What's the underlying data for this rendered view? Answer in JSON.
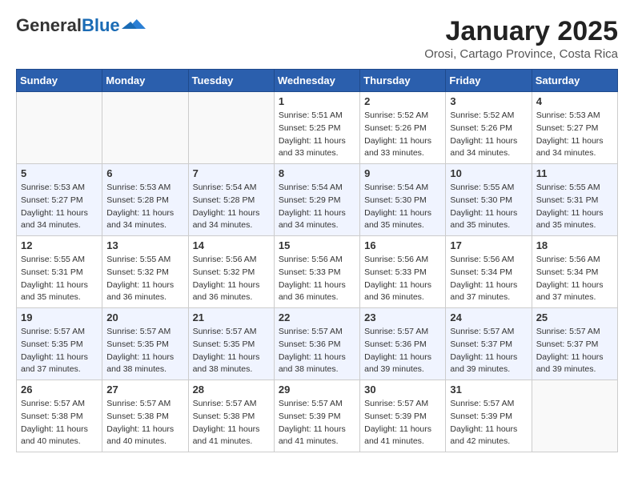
{
  "header": {
    "logo_line1": "General",
    "logo_line2": "Blue",
    "month_title": "January 2025",
    "location": "Orosi, Cartago Province, Costa Rica"
  },
  "weekdays": [
    "Sunday",
    "Monday",
    "Tuesday",
    "Wednesday",
    "Thursday",
    "Friday",
    "Saturday"
  ],
  "weeks": [
    [
      {
        "day": "",
        "info": ""
      },
      {
        "day": "",
        "info": ""
      },
      {
        "day": "",
        "info": ""
      },
      {
        "day": "1",
        "info": "Sunrise: 5:51 AM\nSunset: 5:25 PM\nDaylight: 11 hours\nand 33 minutes."
      },
      {
        "day": "2",
        "info": "Sunrise: 5:52 AM\nSunset: 5:26 PM\nDaylight: 11 hours\nand 33 minutes."
      },
      {
        "day": "3",
        "info": "Sunrise: 5:52 AM\nSunset: 5:26 PM\nDaylight: 11 hours\nand 34 minutes."
      },
      {
        "day": "4",
        "info": "Sunrise: 5:53 AM\nSunset: 5:27 PM\nDaylight: 11 hours\nand 34 minutes."
      }
    ],
    [
      {
        "day": "5",
        "info": "Sunrise: 5:53 AM\nSunset: 5:27 PM\nDaylight: 11 hours\nand 34 minutes."
      },
      {
        "day": "6",
        "info": "Sunrise: 5:53 AM\nSunset: 5:28 PM\nDaylight: 11 hours\nand 34 minutes."
      },
      {
        "day": "7",
        "info": "Sunrise: 5:54 AM\nSunset: 5:28 PM\nDaylight: 11 hours\nand 34 minutes."
      },
      {
        "day": "8",
        "info": "Sunrise: 5:54 AM\nSunset: 5:29 PM\nDaylight: 11 hours\nand 34 minutes."
      },
      {
        "day": "9",
        "info": "Sunrise: 5:54 AM\nSunset: 5:30 PM\nDaylight: 11 hours\nand 35 minutes."
      },
      {
        "day": "10",
        "info": "Sunrise: 5:55 AM\nSunset: 5:30 PM\nDaylight: 11 hours\nand 35 minutes."
      },
      {
        "day": "11",
        "info": "Sunrise: 5:55 AM\nSunset: 5:31 PM\nDaylight: 11 hours\nand 35 minutes."
      }
    ],
    [
      {
        "day": "12",
        "info": "Sunrise: 5:55 AM\nSunset: 5:31 PM\nDaylight: 11 hours\nand 35 minutes."
      },
      {
        "day": "13",
        "info": "Sunrise: 5:55 AM\nSunset: 5:32 PM\nDaylight: 11 hours\nand 36 minutes."
      },
      {
        "day": "14",
        "info": "Sunrise: 5:56 AM\nSunset: 5:32 PM\nDaylight: 11 hours\nand 36 minutes."
      },
      {
        "day": "15",
        "info": "Sunrise: 5:56 AM\nSunset: 5:33 PM\nDaylight: 11 hours\nand 36 minutes."
      },
      {
        "day": "16",
        "info": "Sunrise: 5:56 AM\nSunset: 5:33 PM\nDaylight: 11 hours\nand 36 minutes."
      },
      {
        "day": "17",
        "info": "Sunrise: 5:56 AM\nSunset: 5:34 PM\nDaylight: 11 hours\nand 37 minutes."
      },
      {
        "day": "18",
        "info": "Sunrise: 5:56 AM\nSunset: 5:34 PM\nDaylight: 11 hours\nand 37 minutes."
      }
    ],
    [
      {
        "day": "19",
        "info": "Sunrise: 5:57 AM\nSunset: 5:35 PM\nDaylight: 11 hours\nand 37 minutes."
      },
      {
        "day": "20",
        "info": "Sunrise: 5:57 AM\nSunset: 5:35 PM\nDaylight: 11 hours\nand 38 minutes."
      },
      {
        "day": "21",
        "info": "Sunrise: 5:57 AM\nSunset: 5:35 PM\nDaylight: 11 hours\nand 38 minutes."
      },
      {
        "day": "22",
        "info": "Sunrise: 5:57 AM\nSunset: 5:36 PM\nDaylight: 11 hours\nand 38 minutes."
      },
      {
        "day": "23",
        "info": "Sunrise: 5:57 AM\nSunset: 5:36 PM\nDaylight: 11 hours\nand 39 minutes."
      },
      {
        "day": "24",
        "info": "Sunrise: 5:57 AM\nSunset: 5:37 PM\nDaylight: 11 hours\nand 39 minutes."
      },
      {
        "day": "25",
        "info": "Sunrise: 5:57 AM\nSunset: 5:37 PM\nDaylight: 11 hours\nand 39 minutes."
      }
    ],
    [
      {
        "day": "26",
        "info": "Sunrise: 5:57 AM\nSunset: 5:38 PM\nDaylight: 11 hours\nand 40 minutes."
      },
      {
        "day": "27",
        "info": "Sunrise: 5:57 AM\nSunset: 5:38 PM\nDaylight: 11 hours\nand 40 minutes."
      },
      {
        "day": "28",
        "info": "Sunrise: 5:57 AM\nSunset: 5:38 PM\nDaylight: 11 hours\nand 41 minutes."
      },
      {
        "day": "29",
        "info": "Sunrise: 5:57 AM\nSunset: 5:39 PM\nDaylight: 11 hours\nand 41 minutes."
      },
      {
        "day": "30",
        "info": "Sunrise: 5:57 AM\nSunset: 5:39 PM\nDaylight: 11 hours\nand 41 minutes."
      },
      {
        "day": "31",
        "info": "Sunrise: 5:57 AM\nSunset: 5:39 PM\nDaylight: 11 hours\nand 42 minutes."
      },
      {
        "day": "",
        "info": ""
      }
    ]
  ]
}
